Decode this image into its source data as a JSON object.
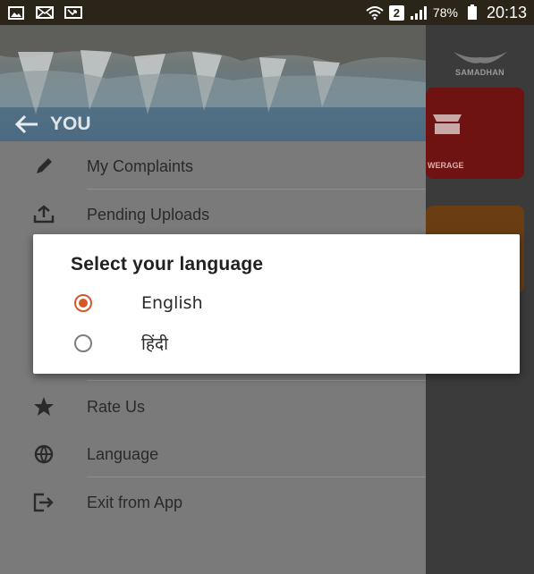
{
  "status_bar": {
    "sim_slot": "2",
    "battery_percent": "78%",
    "time": "20:13",
    "icons": [
      "gallery-icon",
      "mail-icon",
      "missed-call-icon",
      "wifi-icon",
      "signal-icon",
      "battery-icon"
    ]
  },
  "app_background": {
    "brand_text": "SAMADHAN",
    "tile_label": "WERAGE",
    "colors": {
      "tile_sewerage": "#6e1212",
      "tile_second": "#6b3d12"
    }
  },
  "drawer": {
    "title": "YOU",
    "back_icon": "arrow-left-icon",
    "items": [
      {
        "label": "My Complaints",
        "icon": "pencil-icon"
      },
      {
        "label": "Pending Uploads",
        "icon": "upload-icon"
      },
      {
        "label": "Rate Us",
        "icon": "star-icon"
      },
      {
        "label": "Language",
        "icon": "globe-icon"
      },
      {
        "label": "Exit from App",
        "icon": "exit-icon"
      }
    ]
  },
  "dialog": {
    "title": "Select your language",
    "options": [
      {
        "label": "English",
        "selected": true
      },
      {
        "label": "हिंदी",
        "selected": false
      }
    ],
    "accent_color": "#d4582a"
  }
}
